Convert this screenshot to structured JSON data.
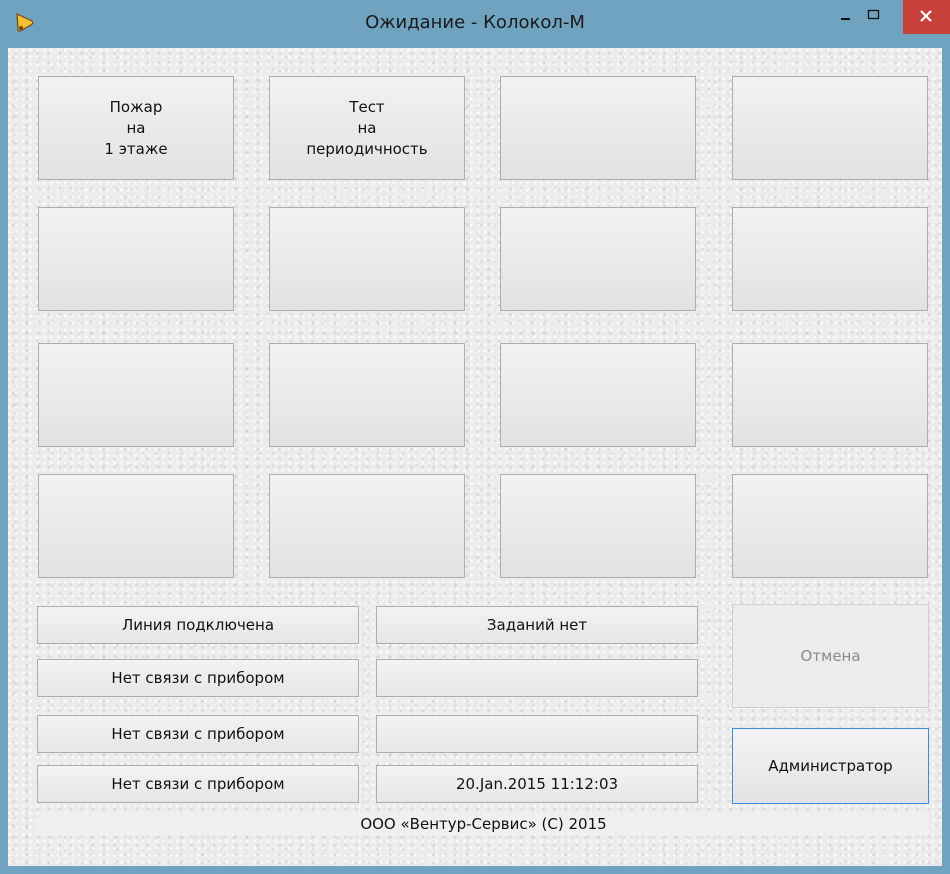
{
  "window": {
    "title": "Ожидание - Колокол-М",
    "icon": "bell-icon",
    "colors": {
      "frame": "#6fa3bf",
      "close": "#c8403a",
      "focus": "#3c8de0"
    }
  },
  "tiles": [
    "Пожар\nна\n1 этаже",
    "Тест\nна\nпериодичность",
    "",
    "",
    "",
    "",
    "",
    "",
    "",
    "",
    "",
    "",
    "",
    "",
    "",
    ""
  ],
  "status": {
    "line": "Линия подключена",
    "tasks": "Заданий нет",
    "device_1": "Нет связи с прибором",
    "device_2": "Нет связи с прибором",
    "device_3": "Нет связи с прибором",
    "extra_1": "",
    "extra_2": "",
    "datetime": "20.Jan.2015 11:12:03"
  },
  "buttons": {
    "cancel": "Отмена",
    "admin": "Администратор"
  },
  "footer": "ООО «Вентур-Сервис» (С) 2015"
}
